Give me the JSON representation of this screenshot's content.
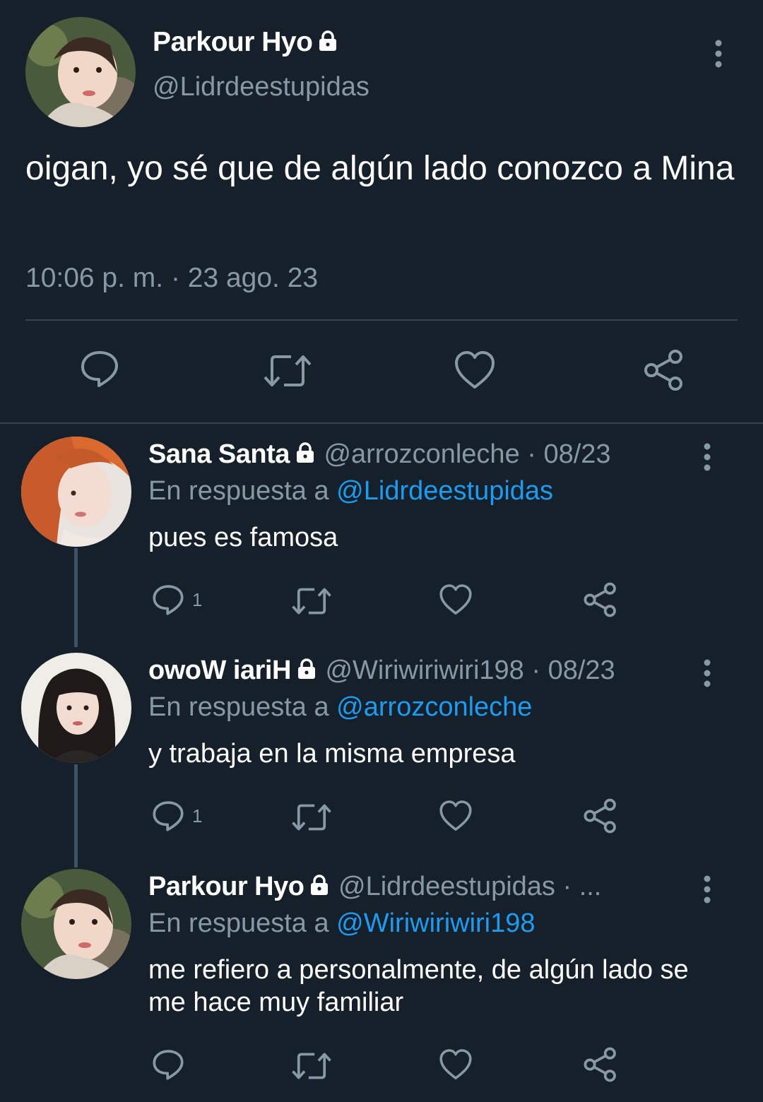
{
  "main_tweet": {
    "display_name": "Parkour Hyo",
    "handle": "@Lidrdeestupidas",
    "text": "oigan, yo sé que de algún lado conozco a Mina",
    "timestamp": "10:06 p. m. · 23 ago. 23",
    "icons": [
      "reply-icon",
      "retweet-icon",
      "like-icon",
      "share-icon"
    ]
  },
  "replies": [
    {
      "display_name": "Sana Santa",
      "handle": "@arrozconleche",
      "date": "· 08/23",
      "reply_prefix": "En respuesta a ",
      "reply_to": "@Lidrdeestupidas",
      "text": "pues es famosa",
      "reply_count": "1"
    },
    {
      "display_name": "owoW iariH",
      "handle": "@Wiriwiriwiri198",
      "date": "· 08/23",
      "reply_prefix": "En respuesta a ",
      "reply_to": "@arrozconleche",
      "text": "y trabaja en la misma empresa",
      "reply_count": "1"
    },
    {
      "display_name": "Parkour Hyo",
      "handle": "@Lidrdeestupidas",
      "date": "· ...",
      "reply_prefix": "En respuesta a ",
      "reply_to": "@Wiriwiriwiri198",
      "text": "me refiero a personalmente, de algún lado se me hace muy familiar",
      "reply_count": ""
    }
  ],
  "colors": {
    "background": "#15202b",
    "secondary_text": "#8899a6",
    "mention": "#1d9bf0",
    "divider": "#38444d"
  }
}
